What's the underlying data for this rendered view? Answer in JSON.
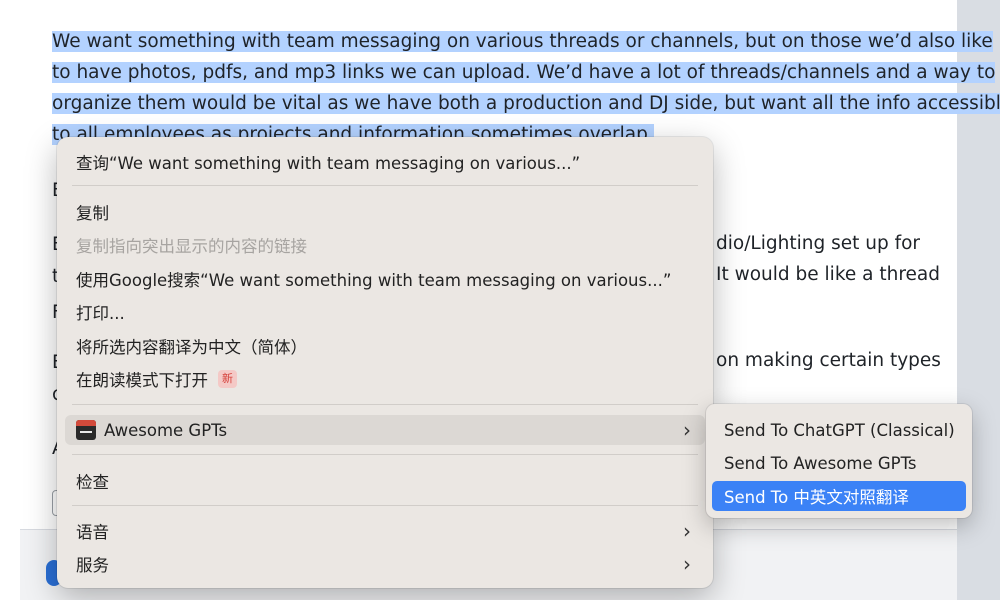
{
  "page": {
    "paragraph_lines": [
      "We want something with team messaging on various threads or channels, but on those we’d also like",
      "to have photos, pdfs, and mp3 links we can upload. We’d have a lot of threads/channels and a way to",
      "organize them would be vital as we have both a production and DJ side, but want all the info accessible",
      "to all employees as projects and information sometimes overlap."
    ],
    "fragments": {
      "e1": "E",
      "e2": "E",
      "t1": "t",
      "p1": "F",
      "e3": "E",
      "c1": "c",
      "a1": "A",
      "right1": "dio/Lighting set up for",
      "right2": "It would be like a thread",
      "right3": "on making certain types"
    }
  },
  "context_menu": {
    "lookup": "查询“We want something with team messaging on various...”",
    "copy": "复制",
    "copy_link_to_highlight": "复制指向突出显示的内容的链接",
    "google_search": "使用Google搜索“We want something with team messaging on various...”",
    "print": "打印...",
    "translate": "将所选内容翻译为中文（简体）",
    "reading_mode": "在朗读模式下打开",
    "reading_mode_badge": "新",
    "awesome_gpts": "Awesome GPTs",
    "inspect": "检查",
    "speech": "语音",
    "services": "服务",
    "chevron": "›"
  },
  "submenu": {
    "items": [
      "Send To ChatGPT (Classical)",
      "Send To Awesome GPTs",
      "Send To 中英文对照翻译"
    ],
    "selected_index": 2
  },
  "colors": {
    "selection_highlight": "#b3d2ff",
    "menu_background": "#ebe7e3",
    "selected_item": "#3b82f6"
  }
}
